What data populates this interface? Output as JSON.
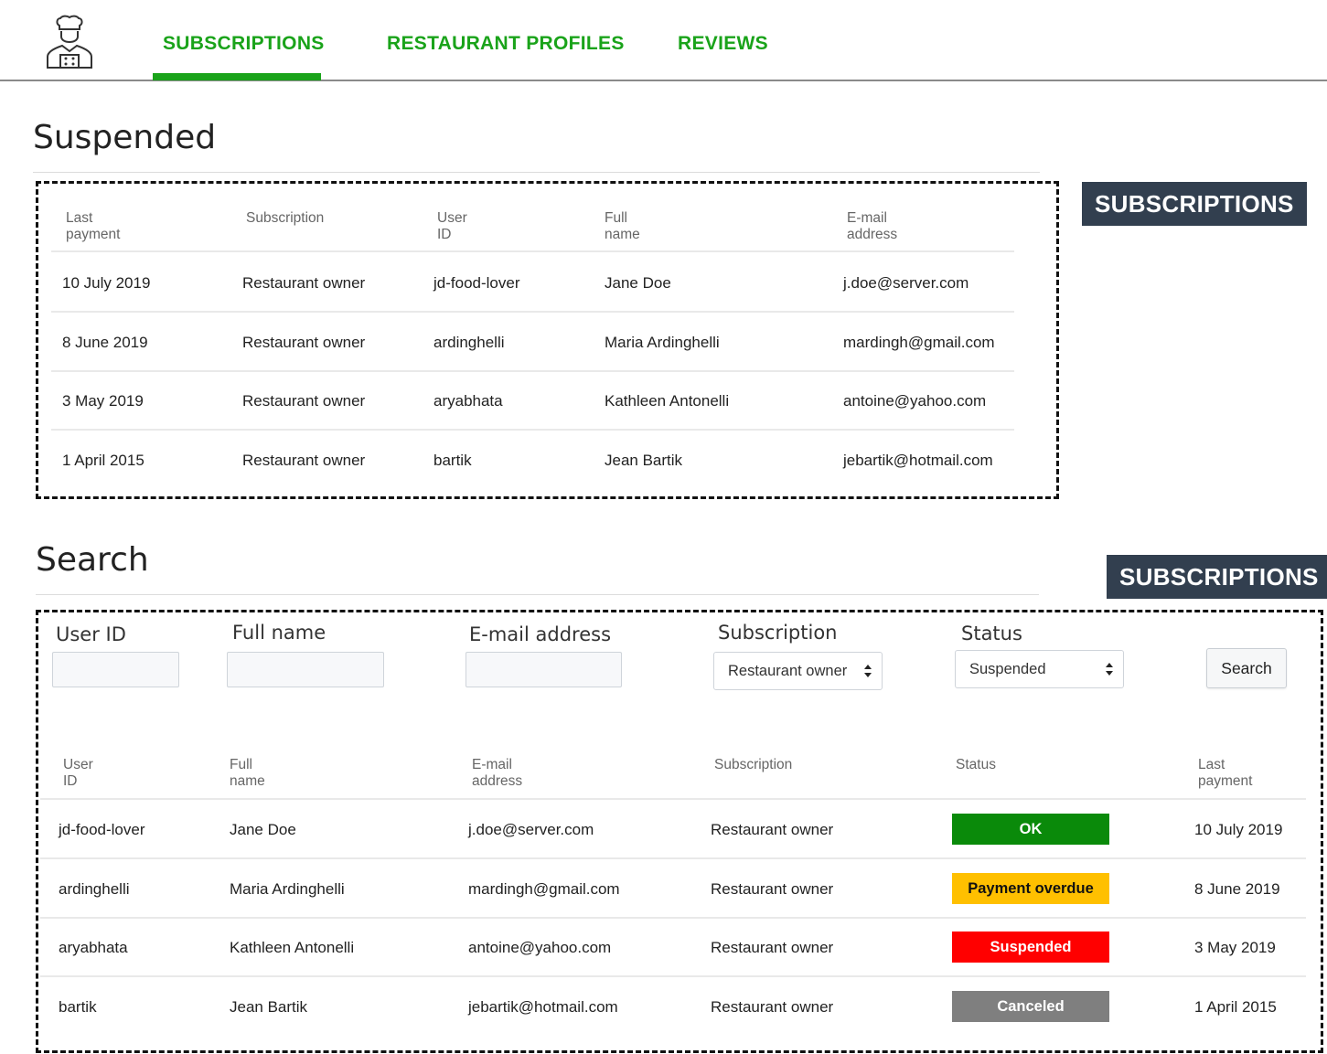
{
  "nav": {
    "tabs": [
      {
        "label": "SUBSCRIPTIONS",
        "active": true
      },
      {
        "label": "RESTAURANT PROFILES",
        "active": false
      },
      {
        "label": "REVIEWS",
        "active": false
      }
    ],
    "logo_icon": "chef-icon",
    "accent_color": "#1aa31a"
  },
  "suspended": {
    "title": "Suspended",
    "badge": "SUBSCRIPTIONS",
    "columns": [
      "Last payment",
      "Subscription",
      "User ID",
      "Full name",
      "E-mail address"
    ],
    "rows": [
      [
        "10 July 2019",
        "Restaurant owner",
        "jd-food-lover",
        "Jane Doe",
        "j.doe@server.com"
      ],
      [
        "8 June 2019",
        "Restaurant owner",
        "ardinghelli",
        "Maria Ardinghelli",
        "mardingh@gmail.com"
      ],
      [
        "3 May 2019",
        "Restaurant owner",
        "aryabhata",
        "Kathleen Antonelli",
        "antoine@yahoo.com"
      ],
      [
        "1 April 2015",
        "Restaurant owner",
        "bartik",
        "Jean Bartik",
        "jebartik@hotmail.com"
      ]
    ]
  },
  "search": {
    "title": "Search",
    "badge": "SUBSCRIPTIONS",
    "form": {
      "user_id_label": "User ID",
      "user_id_value": "",
      "full_name_label": "Full name",
      "full_name_value": "",
      "email_label": "E-mail address",
      "email_value": "",
      "subscription_label": "Subscription",
      "subscription_value": "Restaurant owner",
      "status_label": "Status",
      "status_value": "Suspended",
      "search_button": "Search"
    },
    "columns": [
      "User ID",
      "Full name",
      "E-mail address",
      "Subscription",
      "Status",
      "Last payment"
    ],
    "rows": [
      {
        "user_id": "jd-food-lover",
        "full_name": "Jane Doe",
        "email": "j.doe@server.com",
        "subscription": "Restaurant owner",
        "status": "OK",
        "status_color": "#0a8a0a",
        "status_text_color": "#ffffff",
        "last_payment": "10 July 2019"
      },
      {
        "user_id": "ardinghelli",
        "full_name": "Maria Ardinghelli",
        "email": "mardingh@gmail.com",
        "subscription": "Restaurant owner",
        "status": "Payment overdue",
        "status_color": "#ffc000",
        "status_text_color": "#111111",
        "last_payment": "8 June 2019"
      },
      {
        "user_id": "aryabhata",
        "full_name": "Kathleen Antonelli",
        "email": "antoine@yahoo.com",
        "subscription": "Restaurant owner",
        "status": "Suspended",
        "status_color": "#ff0000",
        "status_text_color": "#ffffff",
        "last_payment": "3 May 2019"
      },
      {
        "user_id": "bartik",
        "full_name": "Jean Bartik",
        "email": "jebartik@hotmail.com",
        "subscription": "Restaurant owner",
        "status": "Canceled",
        "status_color": "#7f7f7f",
        "status_text_color": "#ffffff",
        "last_payment": "1 April 2015"
      }
    ]
  }
}
